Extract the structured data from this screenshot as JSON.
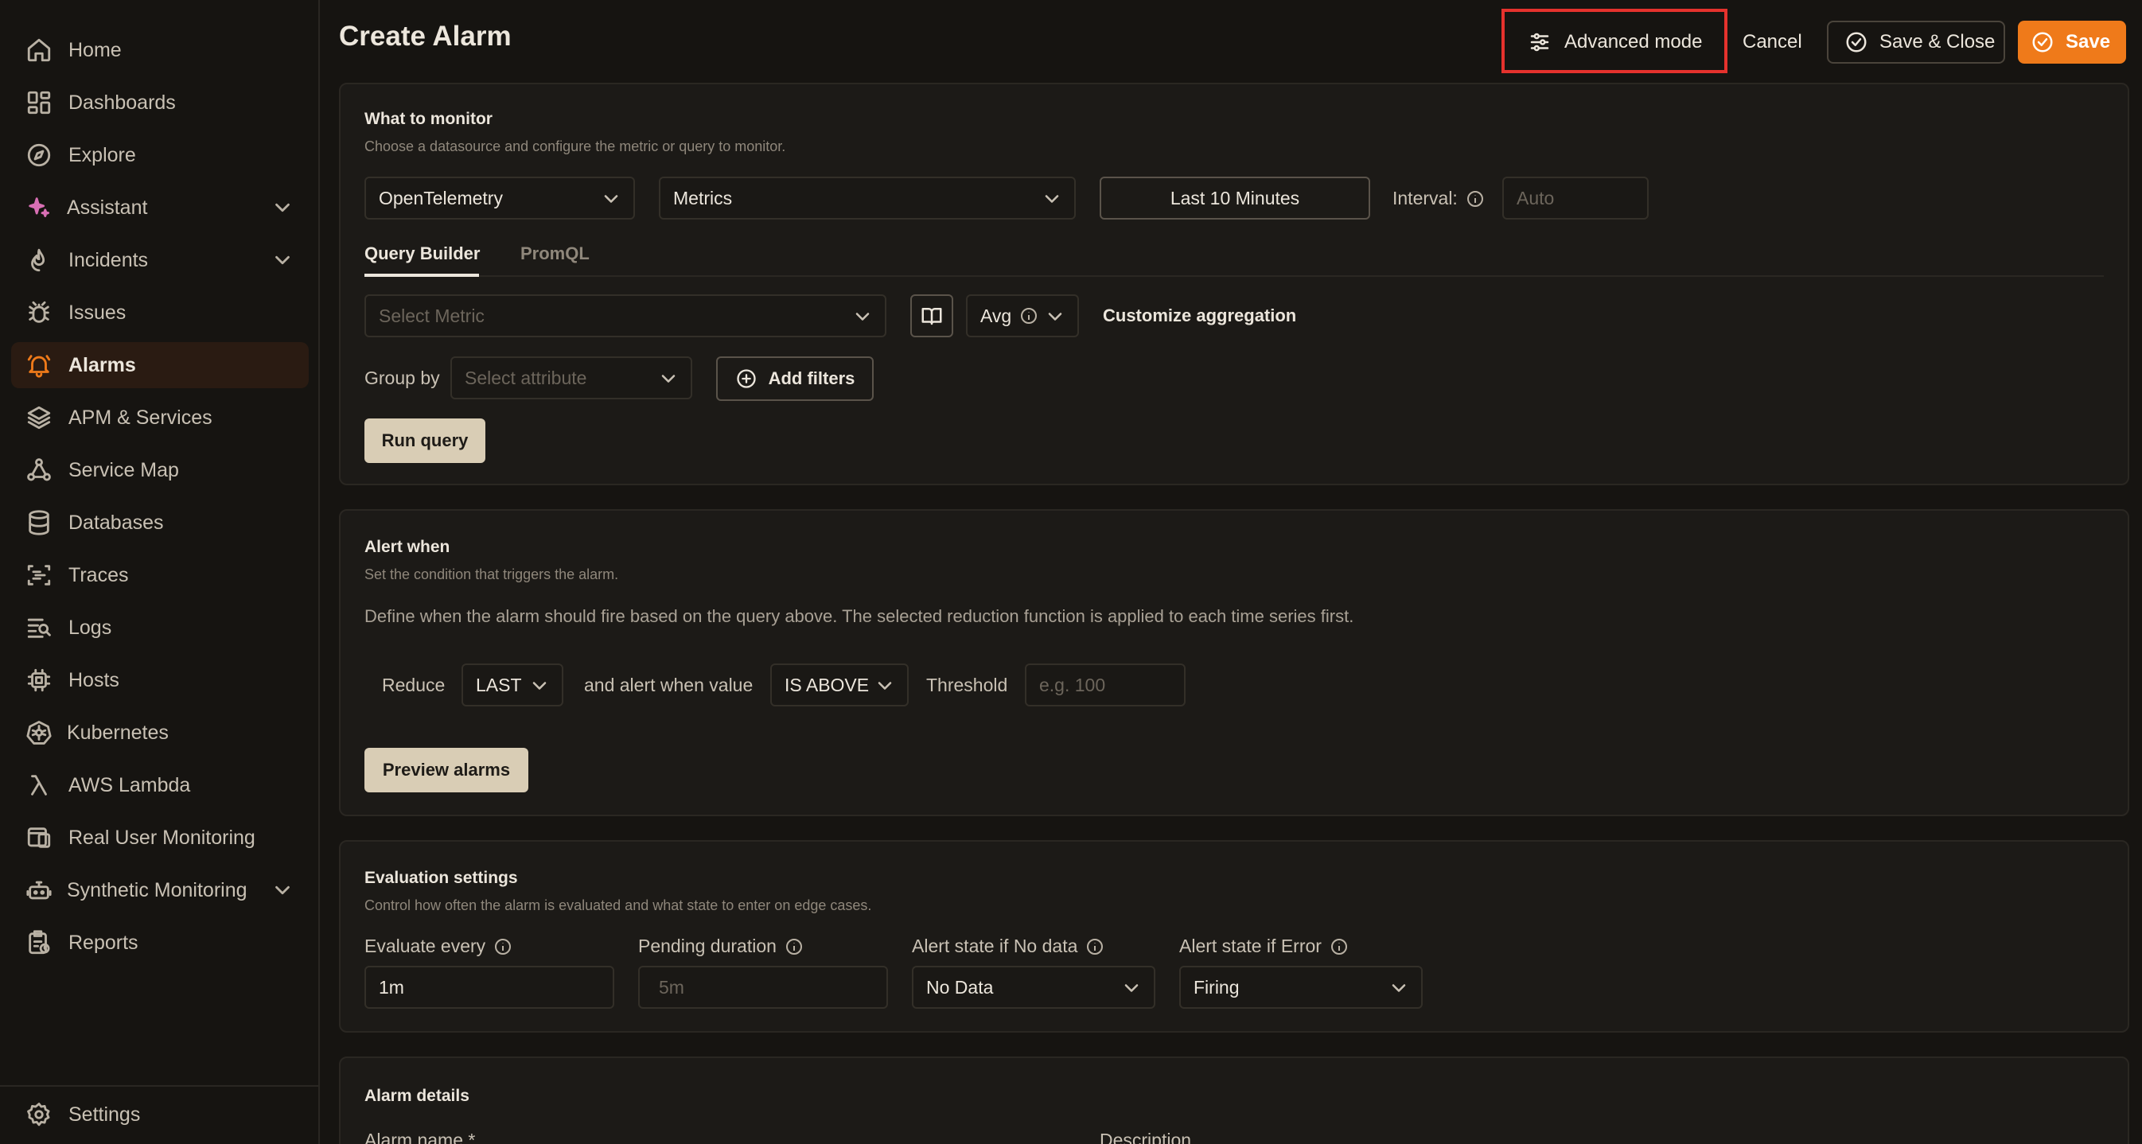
{
  "sidebar": {
    "items": [
      {
        "label": "Home",
        "icon": "home-icon"
      },
      {
        "label": "Dashboards",
        "icon": "dashboard-icon"
      },
      {
        "label": "Explore",
        "icon": "compass-icon"
      },
      {
        "label": "Assistant",
        "icon": "sparkle-icon",
        "expandable": true
      },
      {
        "label": "Incidents",
        "icon": "flame-icon",
        "expandable": true
      },
      {
        "label": "Issues",
        "icon": "bug-icon"
      },
      {
        "label": "Alarms",
        "icon": "bell-icon",
        "active": true
      },
      {
        "label": "APM & Services",
        "icon": "layers-icon"
      },
      {
        "label": "Service Map",
        "icon": "network-icon"
      },
      {
        "label": "Databases",
        "icon": "database-icon"
      },
      {
        "label": "Traces",
        "icon": "traces-icon"
      },
      {
        "label": "Logs",
        "icon": "logs-icon"
      },
      {
        "label": "Hosts",
        "icon": "chip-icon"
      },
      {
        "label": "Kubernetes",
        "icon": "kubernetes-icon"
      },
      {
        "label": "AWS Lambda",
        "icon": "lambda-icon"
      },
      {
        "label": "Real User Monitoring",
        "icon": "rum-icon"
      },
      {
        "label": "Synthetic Monitoring",
        "icon": "robot-icon",
        "expandable": true
      },
      {
        "label": "Reports",
        "icon": "reports-icon"
      }
    ],
    "settings_label": "Settings"
  },
  "header": {
    "title": "Create Alarm",
    "advanced_mode": "Advanced mode",
    "cancel": "Cancel",
    "save_close": "Save & Close",
    "save": "Save"
  },
  "monitor": {
    "title": "What to monitor",
    "subtitle": "Choose a datasource and configure the metric or query to monitor.",
    "datasource": "OpenTelemetry",
    "type": "Metrics",
    "time_range": "Last 10 Minutes",
    "interval_label": "Interval:",
    "interval_placeholder": "Auto",
    "tabs": [
      "Query Builder",
      "PromQL"
    ],
    "metric_placeholder": "Select Metric",
    "aggregation": "Avg",
    "customize_aggregation": "Customize aggregation",
    "group_by_label": "Group by",
    "attribute_placeholder": "Select attribute",
    "add_filters": "Add filters",
    "run_query": "Run query"
  },
  "alert": {
    "title": "Alert when",
    "subtitle": "Set the condition that triggers the alarm.",
    "description": "Define when the alarm should fire based on the query above. The selected reduction function is applied to each time series first.",
    "reduce_label": "Reduce",
    "reduce_value": "LAST",
    "condition_label": "and alert when value",
    "condition_value": "IS ABOVE",
    "threshold_label": "Threshold",
    "threshold_placeholder": "e.g. 100",
    "preview": "Preview alarms"
  },
  "evaluation": {
    "title": "Evaluation settings",
    "subtitle": "Control how often the alarm is evaluated and what state to enter on edge cases.",
    "evaluate_label": "Evaluate every",
    "evaluate_value": "1m",
    "pending_label": "Pending duration",
    "pending_placeholder": "5m",
    "nodata_label": "Alert state if No data",
    "nodata_value": "No Data",
    "error_label": "Alert state if Error",
    "error_value": "Firing"
  },
  "details": {
    "title": "Alarm details",
    "name_label": "Alarm name *",
    "description_label": "Description"
  },
  "colors": {
    "accent": "#ef7a1a",
    "highlight": "#e5322d",
    "background": "#161411"
  }
}
